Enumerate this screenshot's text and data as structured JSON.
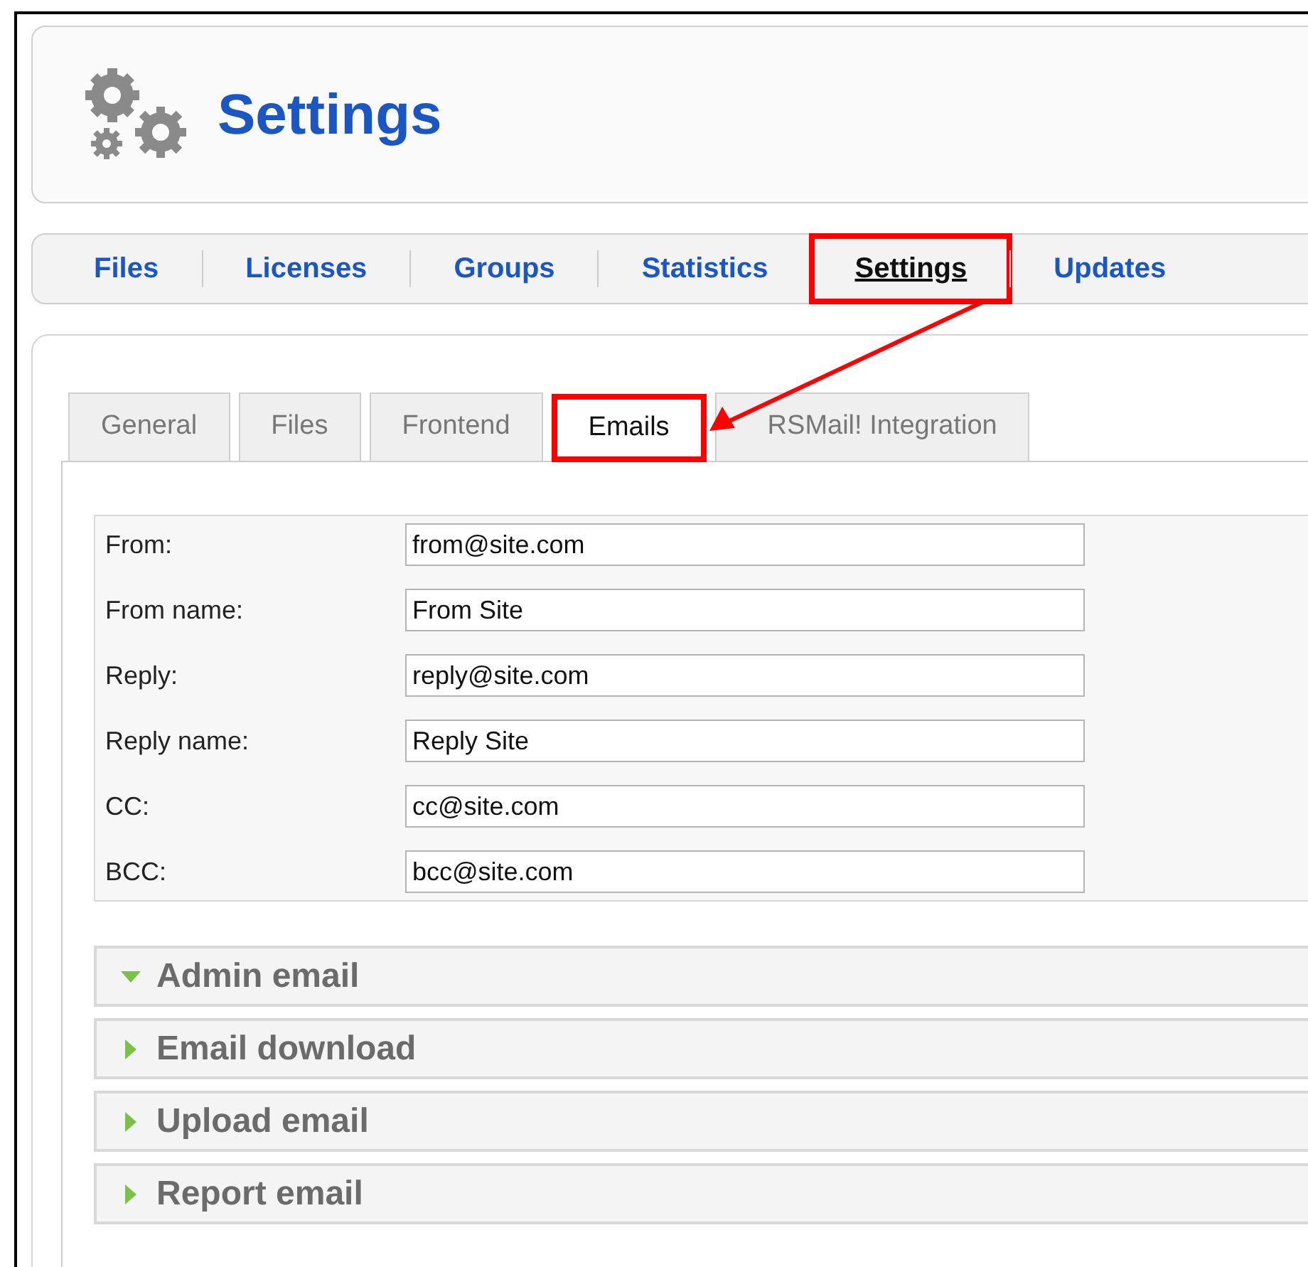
{
  "header": {
    "title": "Settings"
  },
  "nav": [
    {
      "label": "Files",
      "selected": false,
      "highlighted": false
    },
    {
      "label": "Licenses",
      "selected": false,
      "highlighted": false
    },
    {
      "label": "Groups",
      "selected": false,
      "highlighted": false
    },
    {
      "label": "Statistics",
      "selected": false,
      "highlighted": false
    },
    {
      "label": "Settings",
      "selected": true,
      "highlighted": true
    },
    {
      "label": "Updates",
      "selected": false,
      "highlighted": false
    }
  ],
  "tabs": [
    {
      "label": "General",
      "selected": false,
      "highlighted": false
    },
    {
      "label": "Files",
      "selected": false,
      "highlighted": false
    },
    {
      "label": "Frontend",
      "selected": false,
      "highlighted": false
    },
    {
      "label": "Emails",
      "selected": true,
      "highlighted": true
    },
    {
      "label": "RSMail! Integration",
      "selected": false,
      "highlighted": false
    }
  ],
  "fields": [
    {
      "label": "From:",
      "value": "from@site.com"
    },
    {
      "label": "From name:",
      "value": "From Site"
    },
    {
      "label": "Reply:",
      "value": "reply@site.com"
    },
    {
      "label": "Reply name:",
      "value": "Reply Site"
    },
    {
      "label": "CC:",
      "value": "cc@site.com"
    },
    {
      "label": "BCC:",
      "value": "bcc@site.com"
    }
  ],
  "sections": [
    {
      "title": "Admin email",
      "expanded": true
    },
    {
      "title": "Email download",
      "expanded": false
    },
    {
      "title": "Upload email",
      "expanded": false
    },
    {
      "title": "Report email",
      "expanded": false
    }
  ]
}
